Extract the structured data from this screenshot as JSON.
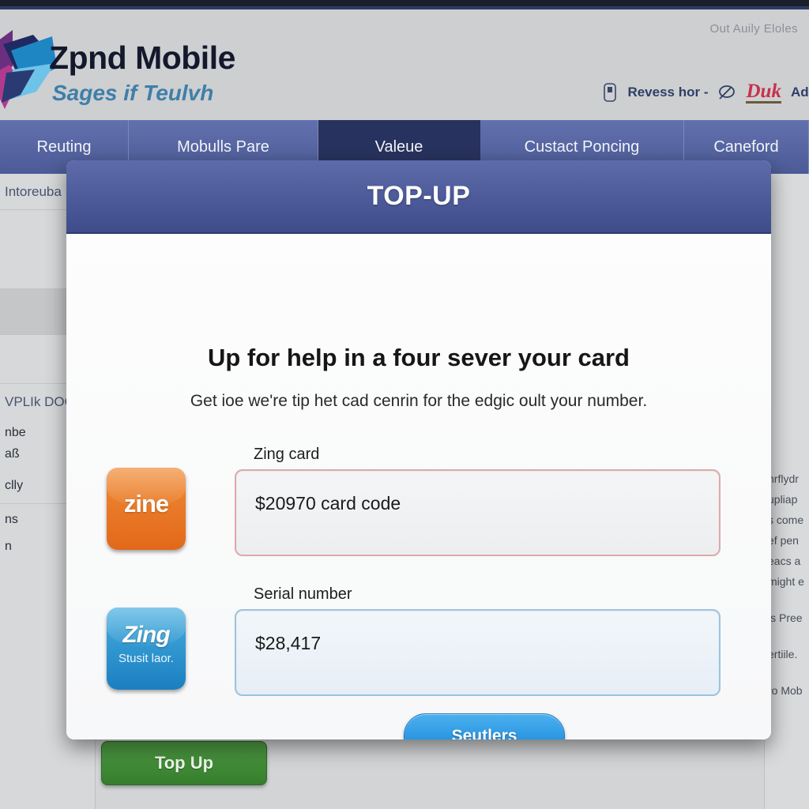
{
  "header": {
    "logo_title": "Zpnd Mobile",
    "logo_tagline": "Sages if Teulvh",
    "utility_text": "Out Auily Eloles",
    "links": {
      "tag_icon": "tag-icon",
      "reverse_label": "Revess hor -",
      "feather_icon": "feather-icon",
      "duk_label": "Duk",
      "ado_label": "Ado"
    }
  },
  "nav": {
    "items": [
      {
        "label": "Reuting",
        "active": false
      },
      {
        "label": "Mobulls Pare",
        "active": false
      },
      {
        "label": "Valeue",
        "active": true
      },
      {
        "label": "Custact Poncing",
        "active": false
      },
      {
        "label": "Caneford",
        "active": false
      }
    ]
  },
  "sidebar": {
    "rows": [
      {
        "label": "Intoreuba"
      },
      {
        "label": ""
      },
      {
        "label": ""
      },
      {
        "label": ""
      },
      {
        "label": "VPLIk DOC"
      },
      {
        "label": "nbe"
      },
      {
        "label": "aß"
      },
      {
        "label": "clly"
      },
      {
        "label": "ns"
      },
      {
        "label": "n"
      }
    ]
  },
  "right_column": {
    "lines": [
      "hrflydr",
      "upliap",
      "s come",
      "ef pen",
      "eacs a",
      "might e",
      "ls Pree",
      "ertiile.",
      "ro Mob"
    ]
  },
  "page_actions": {
    "top_up_label": "Top Up"
  },
  "modal": {
    "title": "TOP-UP",
    "heading": "Up for help in a four sever your card",
    "subheading": "Get ioe we're tip het cad cenrin for the edgic oult your number.",
    "fields": [
      {
        "label": "Zing card",
        "value": "$20970 card code",
        "placeholder": "$20970 card code",
        "badge_main": "zine",
        "badge_sub": "",
        "accent": "#dfa8ab"
      },
      {
        "label": "Serial number",
        "value": "$28,417",
        "placeholder": "$28,417",
        "badge_main": "Zing",
        "badge_sub": "Stusit laor.",
        "accent": "#9dc3dc"
      }
    ],
    "submit_label": "Seutlers"
  },
  "colors": {
    "nav_bg": "#4c5b97",
    "nav_active": "#28325e",
    "modal_header": "#4a5795",
    "submit_blue": "#0f82d8",
    "topup_green": "#357d2c",
    "badge_orange": "#e2681a",
    "badge_blue": "#1b7fc0",
    "duk_red": "#c8304a"
  }
}
